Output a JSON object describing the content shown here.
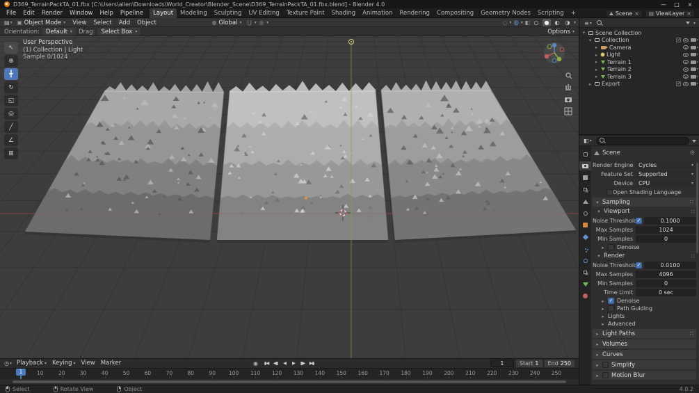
{
  "window": {
    "title": "D369_TerrainPackTA_01.fbx [C:\\Users\\allen\\Downloads\\World_Creator\\Blender_Scene\\D369_TerrainPackTA_01.fbx.blend] - Blender 4.0",
    "controls": {
      "minimize": "—",
      "maximize": "□",
      "close": "×"
    }
  },
  "icons": {
    "dropdown": "▾",
    "collapsed": "▸",
    "expanded": "▾",
    "unlink": "×",
    "editor_viewport": "▤",
    "object_mode": "▣",
    "orientation_globe": "◍",
    "snap_magnet": "⋃",
    "proportional": "◎",
    "gizmo": "◌",
    "overlays": "◍",
    "xray": "◧",
    "shading_wireframe": "○",
    "shading_solid": "●",
    "shading_material": "◐",
    "shading_rendered": "◑",
    "editor_timeline": "◷",
    "editor_outliner": "≡",
    "editor_properties": "◧",
    "panel_menu": "∷",
    "pin": "⊙",
    "autokey": "◉",
    "viewlayer": "▤"
  },
  "menubar": {
    "menus": [
      "File",
      "Edit",
      "Render",
      "Window",
      "Help",
      "Pipeline"
    ],
    "workspaces": [
      "Layout",
      "Modeling",
      "Sculpting",
      "UV Editing",
      "Texture Paint",
      "Shading",
      "Animation",
      "Rendering",
      "Compositing",
      "Geometry Nodes",
      "Scripting"
    ],
    "active_workspace": "Layout",
    "add_tab": "+",
    "scene_selector": {
      "value": "Scene"
    },
    "viewlayer_selector": {
      "value": "ViewLayer"
    }
  },
  "viewport_header": {
    "mode": "Object Mode",
    "menus": [
      "View",
      "Select",
      "Add",
      "Object"
    ],
    "transform_orientation": "Global"
  },
  "tool_settings": {
    "orientation_label": "Orientation:",
    "orientation_value": "Default",
    "drag_label": "Drag:",
    "drag_value": "Select Box",
    "options_label": "Options"
  },
  "toolbar": {
    "tools": [
      {
        "name": "select-box",
        "glyph": "↖",
        "hover": true
      },
      {
        "name": "cursor",
        "glyph": "⊕"
      },
      {
        "name": "move",
        "glyph": "╋",
        "active": true
      },
      {
        "name": "rotate",
        "glyph": "↻"
      },
      {
        "name": "scale",
        "glyph": "◱"
      },
      {
        "name": "transform",
        "glyph": "◎"
      },
      {
        "name": "annotate",
        "glyph": "╱"
      },
      {
        "name": "measure",
        "glyph": "∠"
      },
      {
        "name": "add-cube",
        "glyph": "⊞"
      }
    ]
  },
  "viewport": {
    "overlay": [
      "User Perspective",
      "(1) Collection | Light",
      "Sample 0/1024"
    ],
    "axis_colors": {
      "x": "#9a4040",
      "y": "#7ba23c",
      "z": "#5a86c2"
    }
  },
  "outliner": {
    "rows": [
      {
        "label": "Scene Collection",
        "icon": "scene-collection",
        "indent": 0,
        "arrow": "▾",
        "right": []
      },
      {
        "label": "Collection",
        "icon": "collection",
        "indent": 1,
        "arrow": "▾",
        "right": [
          "check",
          "eye",
          "cam"
        ]
      },
      {
        "label": "Camera",
        "icon": "camera",
        "indent": 2,
        "arrow": "▸",
        "right": [
          "eye",
          "cam"
        ]
      },
      {
        "label": "Light",
        "icon": "light",
        "indent": 2,
        "arrow": "▸",
        "right": [
          "eye",
          "cam"
        ]
      },
      {
        "label": "Terrain 1",
        "icon": "mesh",
        "indent": 2,
        "arrow": "▸",
        "right": [
          "eye",
          "cam"
        ]
      },
      {
        "label": "Terrain 2",
        "icon": "mesh",
        "indent": 2,
        "arrow": "▸",
        "right": [
          "eye",
          "cam"
        ]
      },
      {
        "label": "Terrain 3",
        "icon": "mesh",
        "indent": 2,
        "arrow": "▸",
        "right": [
          "eye",
          "cam"
        ]
      },
      {
        "label": "Export",
        "icon": "collection",
        "indent": 1,
        "arrow": "▸",
        "right": [
          "check",
          "eye",
          "cam"
        ]
      }
    ]
  },
  "properties": {
    "breadcrumb": "Scene",
    "tabs": [
      {
        "name": "tool",
        "shape": "sq-o",
        "color": "#9f9f9f"
      },
      {
        "name": "render",
        "shape": "camera",
        "color": "#cfcfcf",
        "active": true
      },
      {
        "name": "output",
        "shape": "square",
        "color": "#9f9f9f"
      },
      {
        "name": "view-layer",
        "shape": "stack",
        "color": "#9f9f9f"
      },
      {
        "name": "scene",
        "shape": "triangle-up",
        "color": "#9f9f9f"
      },
      {
        "name": "world",
        "shape": "circle-o",
        "color": "#9f9f9f"
      },
      {
        "name": "object",
        "shape": "square",
        "color": "#d8863b"
      },
      {
        "name": "modifiers",
        "shape": "diamond",
        "color": "#5f8fd0"
      },
      {
        "name": "particles",
        "shape": "dots",
        "color": "#5f8fd0"
      },
      {
        "name": "physics",
        "shape": "circle-o",
        "color": "#5f8fd0"
      },
      {
        "name": "constraints",
        "shape": "stack",
        "color": "#9f9f9f"
      },
      {
        "name": "object-data",
        "shape": "triangle-down",
        "color": "#6fbf5a"
      },
      {
        "name": "material",
        "shape": "circle",
        "color": "#c45f5f"
      }
    ],
    "rows": [
      {
        "t": "field",
        "label": "Render Engine",
        "value": "Cycles",
        "dd": true
      },
      {
        "t": "field",
        "label": "Feature Set",
        "value": "Supported",
        "dd": true
      },
      {
        "t": "field",
        "label": "Device",
        "value": "CPU",
        "dd": true
      },
      {
        "t": "checklabel",
        "label": "Open Shading Language",
        "checked": false
      },
      {
        "t": "section",
        "label": "Sampling",
        "open": true,
        "menu": true
      },
      {
        "t": "subheader",
        "label": "Viewport",
        "open": true,
        "menu": true
      },
      {
        "t": "field",
        "label": "Noise Threshold",
        "value": "0.1000",
        "check": true,
        "checked": true
      },
      {
        "t": "field",
        "label": "Max Samples",
        "value": "1024"
      },
      {
        "t": "field",
        "label": "Min Samples",
        "value": "0"
      },
      {
        "t": "collapse",
        "label": "Denoise",
        "check": true,
        "checked": false
      },
      {
        "t": "subheader",
        "label": "Render",
        "open": true,
        "menu": true
      },
      {
        "t": "field",
        "label": "Noise Threshold",
        "value": "0.0100",
        "check": true,
        "checked": true
      },
      {
        "t": "field",
        "label": "Max Samples",
        "value": "4096"
      },
      {
        "t": "field",
        "label": "Min Samples",
        "value": "0"
      },
      {
        "t": "field",
        "label": "Time Limit",
        "value": "0 sec"
      },
      {
        "t": "collapse",
        "label": "Denoise",
        "check": true,
        "checked": true
      },
      {
        "t": "collapse",
        "label": "Path Guiding",
        "check": true,
        "checked": false
      },
      {
        "t": "collapse",
        "label": "Lights"
      },
      {
        "t": "collapse",
        "label": "Advanced"
      },
      {
        "t": "section",
        "label": "Light Paths",
        "open": false,
        "menu": true
      },
      {
        "t": "section",
        "label": "Volumes",
        "open": false
      },
      {
        "t": "section",
        "label": "Curves",
        "open": false
      },
      {
        "t": "section",
        "label": "Simplify",
        "open": false,
        "check": true,
        "checked": false
      },
      {
        "t": "section",
        "label": "Motion Blur",
        "open": false,
        "check": true,
        "checked": false
      }
    ]
  },
  "timeline": {
    "menus": [
      {
        "label": "Playback",
        "dd": true
      },
      {
        "label": "Keying",
        "dd": true
      },
      {
        "label": "View"
      },
      {
        "label": "Marker"
      }
    ],
    "transport": [
      {
        "name": "jump-to-start",
        "glyph": "▮◀"
      },
      {
        "name": "jump-to-prev-keyframe",
        "glyph": "◀▮"
      },
      {
        "name": "play-reverse",
        "glyph": "◀"
      },
      {
        "name": "play",
        "glyph": "▶"
      },
      {
        "name": "jump-to-next-keyframe",
        "glyph": "▮▶"
      },
      {
        "name": "jump-to-end",
        "glyph": "▶▮"
      }
    ],
    "frame_current": "1",
    "start_label": "Start",
    "start_value": "1",
    "end_label": "End",
    "end_value": "250",
    "ruler_frames": [
      1,
      10,
      20,
      30,
      40,
      50,
      60,
      70,
      80,
      90,
      100,
      110,
      120,
      130,
      140,
      150,
      160,
      170,
      180,
      190,
      200,
      210,
      220,
      230,
      240,
      250
    ]
  },
  "statusbar": {
    "hints": [
      {
        "button": "lmb",
        "label": "Select"
      },
      {
        "button": "mmb",
        "label": "Rotate View"
      },
      {
        "button": "rmb",
        "label": "Object"
      }
    ],
    "version": "4.0.2"
  }
}
